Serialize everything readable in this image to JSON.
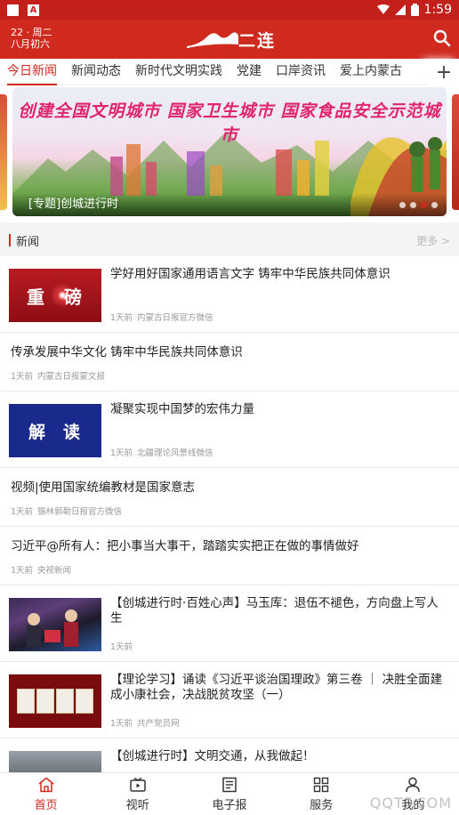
{
  "status_bar": {
    "time": "1:59"
  },
  "header": {
    "date_line1": "22 · 周二",
    "date_line2": "八月初六",
    "logo_text": "二连"
  },
  "tabs": [
    "今日新闻",
    "新闻动态",
    "新时代文明实践",
    "党建",
    "口岸资讯",
    "爱上内蒙古"
  ],
  "tab_add_symbol": "+",
  "banner": {
    "headline": "创建全国文明城市 国家卫生城市 国家食品安全示范城市",
    "caption": "[专题]创城进行时",
    "dots": 4,
    "active_dot": 2
  },
  "section": {
    "title": "新闻",
    "more": "更多 >"
  },
  "news": [
    {
      "type": "thumb",
      "thumb": "重磅",
      "thumb_style": "t-zhong",
      "title": "学好用好国家通用语言文字 铸牢中华民族共同体意识",
      "time": "1天前",
      "source": "内蒙古日报官方微信"
    },
    {
      "type": "text",
      "title": "传承发展中华文化 铸牢中华民族共同体意识",
      "time": "1天前",
      "source": "内蒙古日报蒙文报"
    },
    {
      "type": "thumb",
      "thumb": "解读",
      "thumb_style": "t-jiedu",
      "title": "凝聚实现中国梦的宏伟力量",
      "time": "1天前",
      "source": "北疆理论风景线微信"
    },
    {
      "type": "text",
      "title": "视频|使用国家统编教材是国家意志",
      "time": "1天前",
      "source": "锡林郭勒日报官方微信"
    },
    {
      "type": "text",
      "title": "习近平@所有人：把小事当大事干，踏踏实实把正在做的事情做好",
      "time": "1天前",
      "source": "央视新闻"
    },
    {
      "type": "thumb",
      "thumb": "",
      "thumb_style": "t-photo1",
      "title": "【创城进行时·百姓心声】马玉库：退伍不褪色，方向盘上写人生",
      "time": "1天前",
      "source": ""
    },
    {
      "type": "thumb",
      "thumb": "",
      "thumb_style": "t-photo2",
      "title": "【理论学习】诵读《习近平谈治国理政》第三卷 ｜ 决胜全面建成小康社会，决战脱贫攻坚（一）",
      "time": "1天前",
      "source": "共产党员网"
    },
    {
      "type": "thumb",
      "thumb": "",
      "thumb_style": "t-photo3",
      "title": "【创城进行时】文明交通，从我做起！",
      "time": "",
      "source": ""
    }
  ],
  "bottom_nav": [
    {
      "label": "首页",
      "icon": "home-icon",
      "active": true
    },
    {
      "label": "视听",
      "icon": "video-icon",
      "active": false
    },
    {
      "label": "电子报",
      "icon": "newspaper-icon",
      "active": false
    },
    {
      "label": "服务",
      "icon": "grid-icon",
      "active": false
    },
    {
      "label": "我的",
      "icon": "user-icon",
      "active": false
    }
  ],
  "watermark": "QQTF.COM",
  "colors": {
    "brand_red": "#d02a1f",
    "status_red": "#c4201b"
  }
}
